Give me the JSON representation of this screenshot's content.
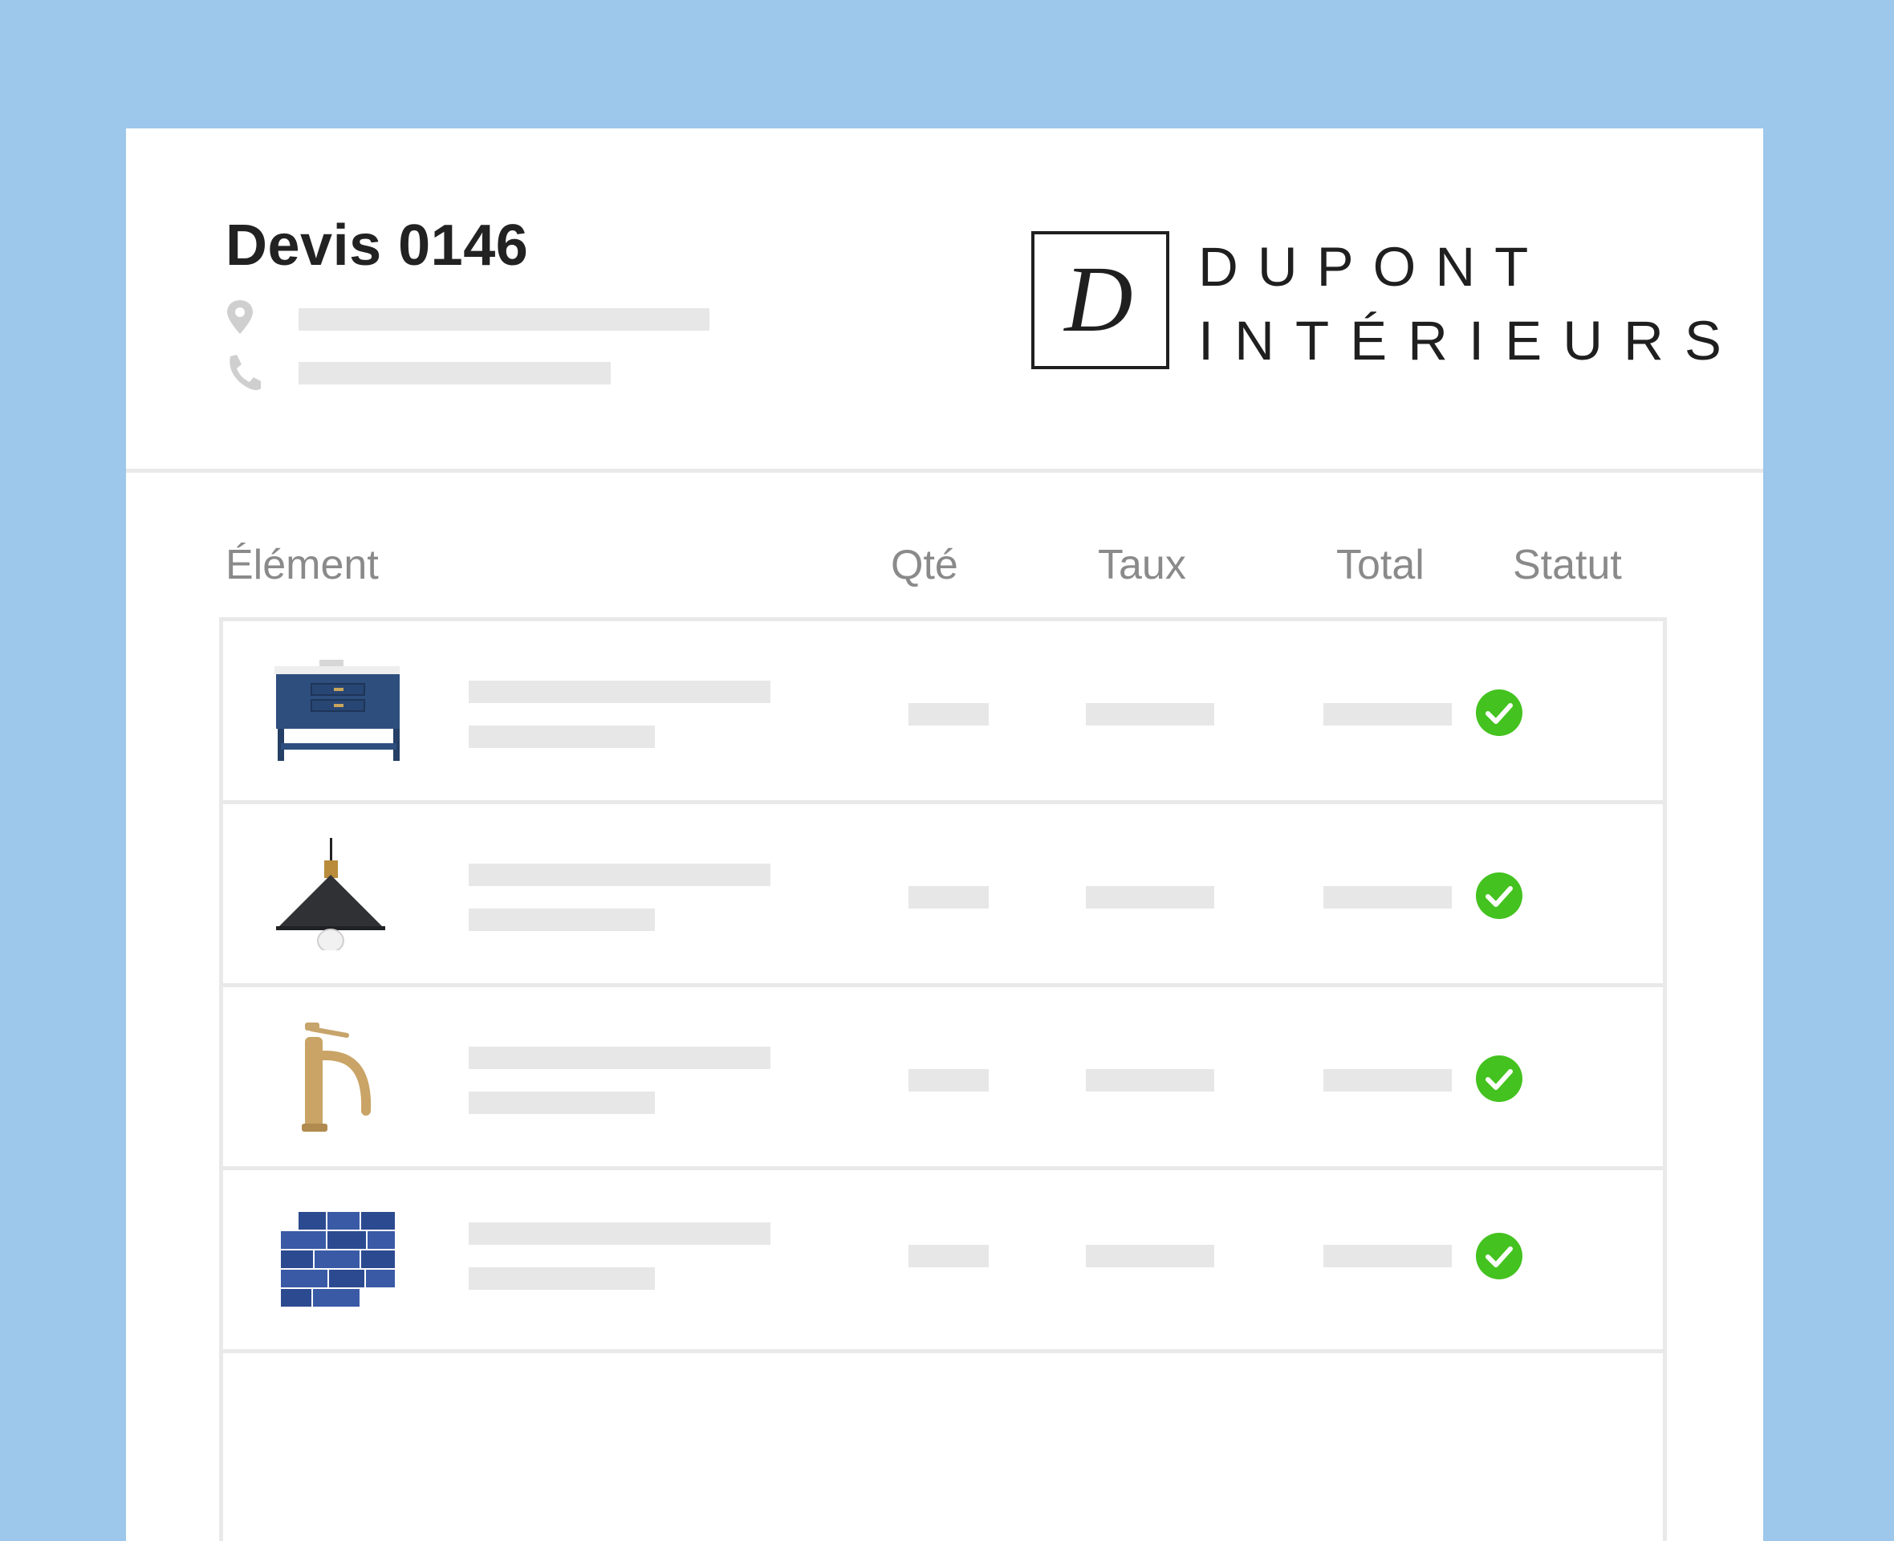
{
  "document": {
    "title": "Devis 0146"
  },
  "brand": {
    "monogram": "D",
    "name_line1": "DUPONT",
    "name_line2": "INTÉRIEURS"
  },
  "icons": {
    "address": "location-pin-icon",
    "phone": "phone-icon",
    "status": "check-circle-icon"
  },
  "table": {
    "headers": {
      "item": "Élément",
      "qty": "Qté",
      "rate": "Taux",
      "total": "Total",
      "status": "Statut"
    },
    "rows": [
      {
        "product": "vanity-cabinet-icon",
        "status": "complete"
      },
      {
        "product": "pendant-lamp-icon",
        "status": "complete"
      },
      {
        "product": "faucet-icon",
        "status": "complete"
      },
      {
        "product": "blue-tile-icon",
        "status": "complete"
      }
    ]
  },
  "colors": {
    "background": "#9dc7eb",
    "check": "#44c21f",
    "placeholder": "#e7e7e7",
    "header_text": "#8a8a8a"
  }
}
